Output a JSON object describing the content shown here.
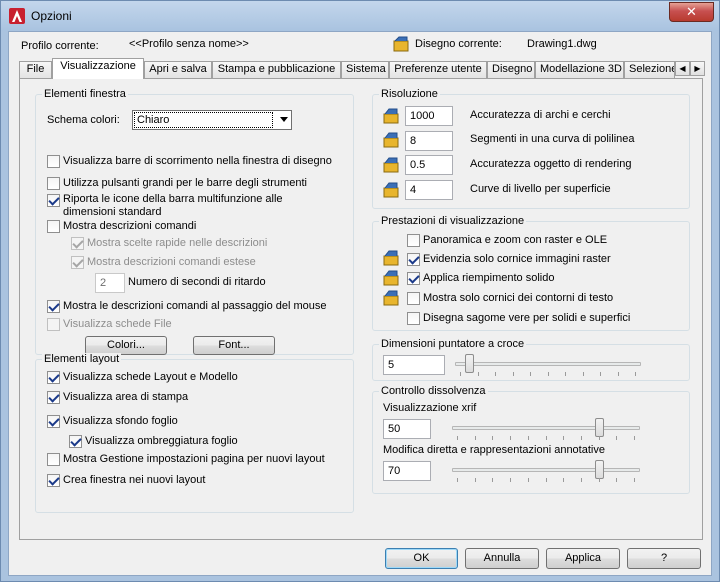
{
  "window": {
    "title": "Opzioni",
    "close_glyph": "✕"
  },
  "header": {
    "profile_label": "Profilo corrente:",
    "profile_value": "<<Profilo senza nome>>",
    "drawing_label": "Disegno corrente:",
    "drawing_value": "Drawing1.dwg"
  },
  "tabs": [
    "File",
    "Visualizzazione",
    "Apri e salva",
    "Stampa e pubblicazione",
    "Sistema",
    "Preferenze utente",
    "Disegno",
    "Modellazione 3D",
    "Selezione"
  ],
  "tab_scroll": {
    "left": "◀",
    "right": "▶"
  },
  "elementi_finestra": {
    "title": "Elementi finestra",
    "scheme_label": "Schema colori:",
    "scheme_value": "Chiaro",
    "options": [
      {
        "label": "Visualizza barre di scorrimento nella finestra di disegno",
        "checked": false
      },
      {
        "label": "Utilizza pulsanti grandi per le barre degli strumenti",
        "checked": false
      },
      {
        "label": "Riporta le icone della barra multifunzione alle",
        "label2": "dimensioni standard",
        "checked": true
      },
      {
        "label": "Mostra descrizioni comandi",
        "checked": false
      },
      {
        "label": "Mostra scelte rapide nelle descrizioni",
        "checked": true,
        "disabled": true
      },
      {
        "label": "Mostra descrizioni comandi estese",
        "checked": true,
        "disabled": true
      },
      {
        "label": "Mostra le descrizioni comandi al passaggio del mouse",
        "checked": true
      },
      {
        "label": "Visualizza schede File",
        "checked": false,
        "disabled": true
      }
    ],
    "delay_value": "2",
    "delay_label": "Numero di secondi di ritardo",
    "colors_button": "Colori...",
    "font_button": "Font..."
  },
  "elementi_layout": {
    "title": "Elementi layout",
    "options": [
      {
        "label": "Visualizza schede Layout e Modello",
        "checked": true
      },
      {
        "label": "Visualizza area di stampa",
        "checked": true
      },
      {
        "label": "Visualizza sfondo foglio",
        "checked": true
      },
      {
        "label": "Visualizza ombreggiatura foglio",
        "checked": true
      },
      {
        "label": "Mostra Gestione impostazioni pagina per nuovi layout",
        "checked": false
      },
      {
        "label": "Crea finestra nei nuovi layout",
        "checked": true
      }
    ]
  },
  "risoluzione": {
    "title": "Risoluzione",
    "rows": [
      {
        "value": "1000",
        "label": "Accuratezza di archi e cerchi"
      },
      {
        "value": "8",
        "label": "Segmenti in una curva di polilinea"
      },
      {
        "value": "0.5",
        "label": "Accuratezza oggetto di rendering"
      },
      {
        "value": "4",
        "label": "Curve di livello per superficie"
      }
    ]
  },
  "prestazioni": {
    "title": "Prestazioni di visualizzazione",
    "options": [
      {
        "label": "Panoramica e zoom con raster e OLE",
        "checked": false,
        "icon": false
      },
      {
        "label": "Evidenzia solo cornice immagini raster",
        "checked": true,
        "icon": true
      },
      {
        "label": "Applica riempimento solido",
        "checked": true,
        "icon": true
      },
      {
        "label": "Mostra solo cornici dei contorni di testo",
        "checked": false,
        "icon": true
      },
      {
        "label": "Disegna sagome vere per solidi e superfici",
        "checked": false,
        "icon": false
      }
    ]
  },
  "puntatore": {
    "title": "Dimensioni puntatore a croce",
    "value": "5",
    "level": 0.05
  },
  "dissolvenza": {
    "title": "Controllo dissolvenza",
    "xrif_label": "Visualizzazione xrif",
    "xrif_value": "50",
    "xrif_level": 0.8,
    "annot_label": "Modifica diretta e rappresentazioni annotative",
    "annot_value": "70",
    "annot_level": 0.8
  },
  "footer": {
    "ok": "OK",
    "cancel": "Annulla",
    "apply": "Applica",
    "help": "?"
  },
  "colors": {
    "accent": "#3c7fb1",
    "title_bar": "#aac3df",
    "close": "#c75050"
  }
}
